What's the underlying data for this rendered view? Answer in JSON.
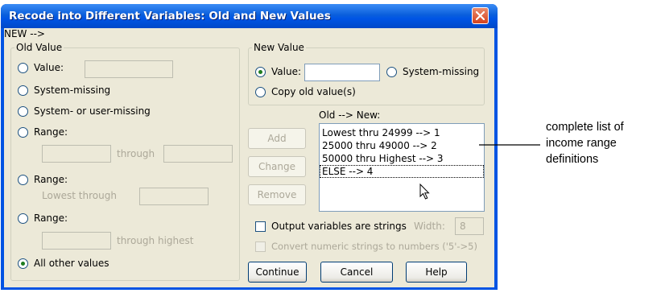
{
  "dialog": {
    "title": "Recode into Different Variables: Old and New Values"
  },
  "old_value": {
    "legend": "Old Value",
    "value_label": "Value:",
    "system_missing_label": "System-missing",
    "sys_or_user_missing_label": "System- or user-missing",
    "range_label": "Range:",
    "through_label": "through",
    "range_lowest_label": "Range:",
    "lowest_through_label": "Lowest through",
    "range_highest_label": "Range:",
    "through_highest_label": "through highest",
    "all_other_label": "All other values",
    "selected": "All other values"
  },
  "new_value": {
    "legend": "New Value",
    "value_label": "Value:",
    "value_input": "",
    "system_missing_label": "System-missing",
    "copy_old_label": "Copy old value(s)",
    "selected": "Value"
  },
  "old_new": {
    "label": "Old --> New:",
    "items": [
      "Lowest thru 24999 --> 1",
      "25000 thru 49000 --> 2",
      "50000 thru Highest --> 3",
      "ELSE --> 4"
    ]
  },
  "buttons": {
    "add": "Add",
    "change": "Change",
    "remove": "Remove",
    "continue": "Continue",
    "cancel": "Cancel",
    "help": "Help"
  },
  "options": {
    "output_strings_label": "Output variables are strings",
    "width_label": "Width:",
    "width_value": "8",
    "convert_label": "Convert numeric strings to numbers ('5'->5)"
  },
  "annotation": {
    "lines": [
      "complete list of",
      "income range",
      "definitions"
    ]
  },
  "icons": {
    "close": "close-icon",
    "cursor": "mouse-pointer-icon"
  },
  "colors": {
    "titlebar": "#0054e3",
    "close_button": "#d5421e",
    "dialog_face": "#ece9d8"
  }
}
